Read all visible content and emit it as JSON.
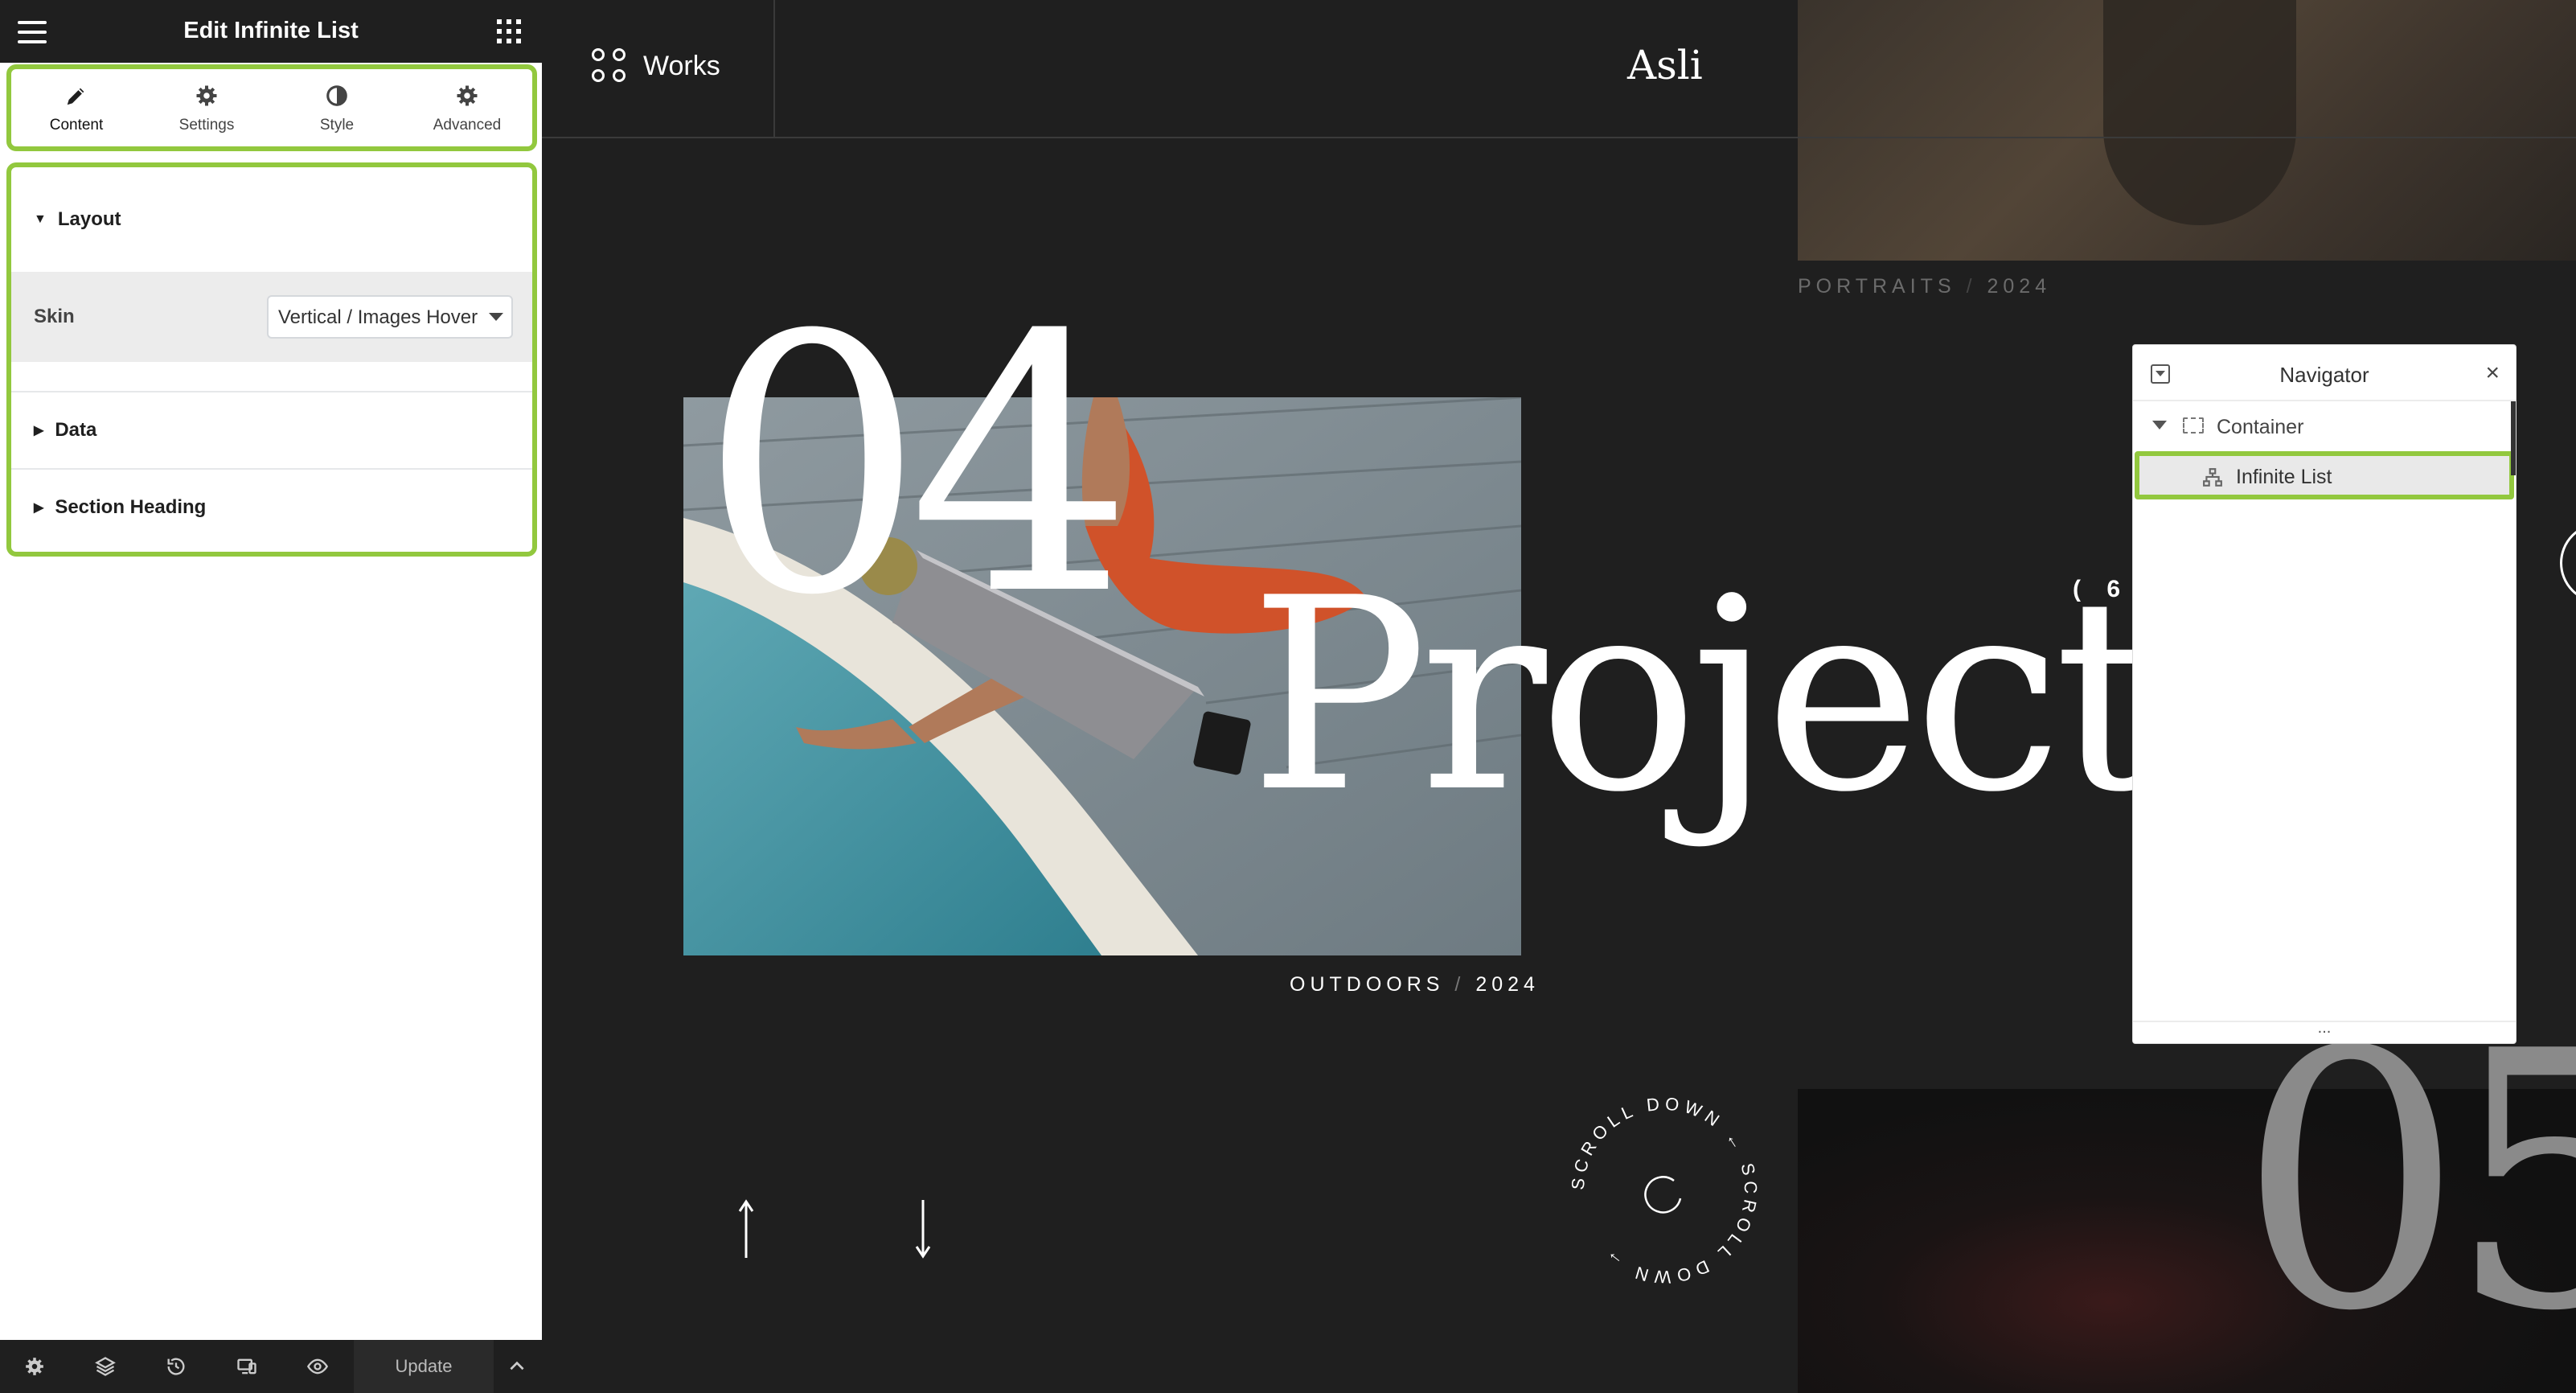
{
  "panel": {
    "title": "Edit Infinite List",
    "tabs": [
      {
        "label": "Content",
        "icon": "pencil-icon"
      },
      {
        "label": "Settings",
        "icon": "gear-icon"
      },
      {
        "label": "Style",
        "icon": "half-circle-icon"
      },
      {
        "label": "Advanced",
        "icon": "gear-icon"
      }
    ],
    "sections": {
      "layout": {
        "label": "Layout",
        "skin_label": "Skin",
        "skin_value": "Vertical / Images Hover"
      },
      "data": {
        "label": "Data"
      },
      "heading": {
        "label": "Section Heading"
      }
    },
    "footer": {
      "update_label": "Update"
    }
  },
  "canvas": {
    "nav_label": "Works",
    "logo": "Asli",
    "portraits_caption": "PORTRAITS",
    "portraits_year": "2024",
    "big_number": "04",
    "projects_word": "Projects",
    "count_text": "( 6",
    "outdoors_caption": "OUTDOORS",
    "outdoors_year": "2024",
    "next_number": "05",
    "scroll_text": "SCROLL DOWN ← SCROLL DOWN →"
  },
  "navigator": {
    "title": "Navigator",
    "items": [
      {
        "label": "Container"
      },
      {
        "label": "Infinite List"
      }
    ],
    "footer": "..."
  },
  "colors": {
    "highlight": "#92c83e",
    "panel_dark": "#1f1f1f",
    "canvas_bg": "#1f1f1f"
  }
}
